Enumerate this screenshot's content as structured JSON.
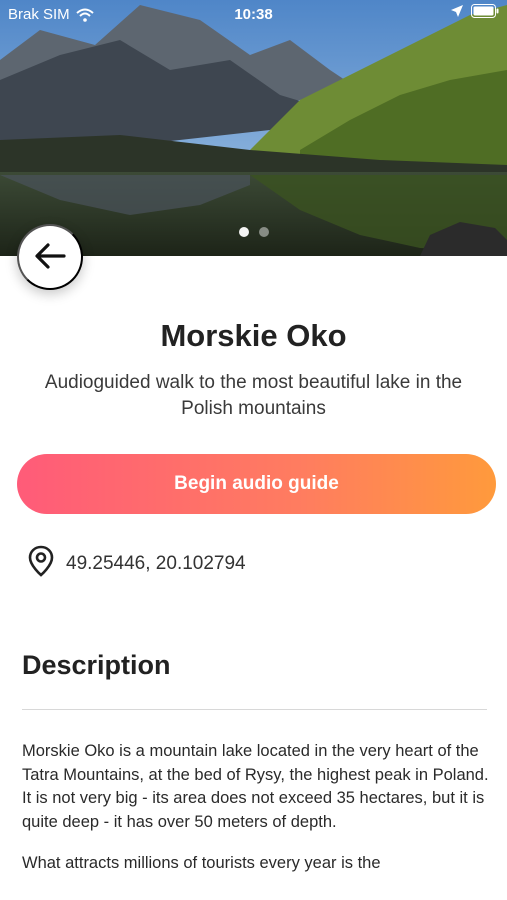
{
  "status_bar": {
    "carrier": "Brak SIM",
    "time": "10:38"
  },
  "gallery": {
    "slide_count": 2,
    "active_slide": 1
  },
  "place": {
    "title": "Morskie Oko",
    "subtitle": "Audioguided walk to the most beautiful lake in the Polish mountains",
    "cta_label": "Begin audio guide",
    "coordinates": "49.25446, 20.102794"
  },
  "description": {
    "heading": "Description",
    "paragraphs": [
      "Morskie Oko is a mountain lake located in the very heart of the Tatra Mountains, at the bed of Rysy, the highest peak in Poland. It is not very big - its area does not exceed 35 hectares, but it is quite deep - it has over 50 meters of depth.",
      "What attracts millions of tourists every year is the"
    ]
  },
  "icons": {
    "back": "arrow-left-icon",
    "location": "map-pin-icon",
    "wifi": "wifi-icon",
    "gps": "location-arrow-icon",
    "battery": "battery-icon"
  },
  "colors": {
    "cta_gradient_start": "#ff5b79",
    "cta_gradient_end": "#ff9a3c"
  }
}
